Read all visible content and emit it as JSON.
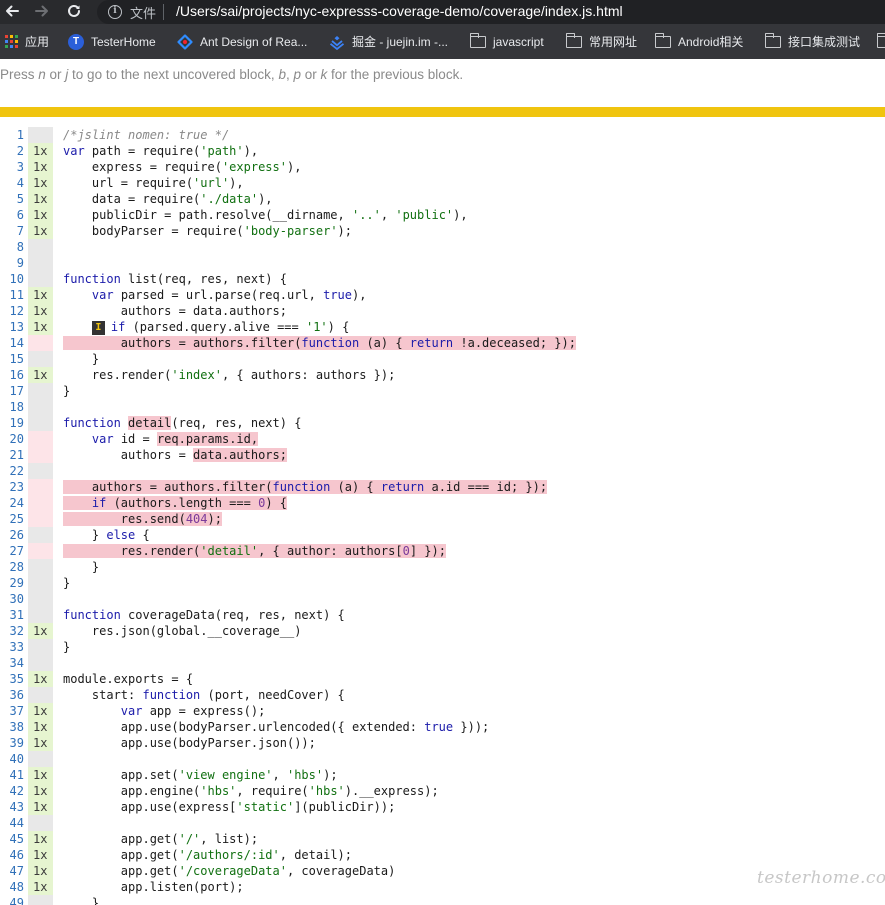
{
  "browser": {
    "back_icon": "arrow-left-icon",
    "forward_icon": "arrow-right-icon",
    "reload_icon": "reload-icon",
    "info_icon": "info-icon",
    "info_glyph": "i",
    "file_label": "文件",
    "url": "/Users/sai/projects/nyc-expresss-coverage-demo/coverage/index.js.html"
  },
  "bookmarks": [
    {
      "label": "应用",
      "icon": "apps-grid-icon"
    },
    {
      "label": "TesterHome",
      "icon": "testerhome-icon",
      "glyph": "T"
    },
    {
      "label": "Ant Design of Rea...",
      "icon": "ant-design-icon"
    },
    {
      "label": "掘金 - juejin.im -...",
      "icon": "juejin-icon"
    },
    {
      "label": "javascript",
      "icon": "folder-icon"
    },
    {
      "label": "常用网址",
      "icon": "folder-icon"
    },
    {
      "label": "Android相关",
      "icon": "folder-icon"
    },
    {
      "label": "接口集成测试",
      "icon": "folder-icon"
    }
  ],
  "help": {
    "t1": "Press ",
    "k1": "n",
    "t2": " or ",
    "k2": "j",
    "t3": " to go to the next uncovered block, ",
    "k3": "b",
    "t4": ", ",
    "k4": "p",
    "t5": " or ",
    "k5": "k",
    "t6": " for the previous block."
  },
  "colors": {
    "status_strip": "#f0c40e",
    "covered_gutter": "#e6f5d0",
    "uncovered_gutter": "#fde4e8",
    "uncovered_code": "#f6c6ce"
  },
  "code": {
    "rows": [
      {
        "n": 1,
        "cnt": "",
        "st": "",
        "segs": [
          [
            "com",
            "/*jslint nomen: true */"
          ]
        ]
      },
      {
        "n": 2,
        "cnt": "1x",
        "st": "yes",
        "segs": [
          [
            "kw",
            "var"
          ],
          [
            "",
            " path = require("
          ],
          [
            "str",
            "'path'"
          ],
          [
            "",
            "),"
          ]
        ]
      },
      {
        "n": 3,
        "cnt": "1x",
        "st": "yes",
        "segs": [
          [
            "",
            "    express = require("
          ],
          [
            "str",
            "'express'"
          ],
          [
            "",
            "),"
          ]
        ]
      },
      {
        "n": 4,
        "cnt": "1x",
        "st": "yes",
        "segs": [
          [
            "",
            "    url = require("
          ],
          [
            "str",
            "'url'"
          ],
          [
            "",
            "),"
          ]
        ]
      },
      {
        "n": 5,
        "cnt": "1x",
        "st": "yes",
        "segs": [
          [
            "",
            "    data = require("
          ],
          [
            "str",
            "'./data'"
          ],
          [
            "",
            "),"
          ]
        ]
      },
      {
        "n": 6,
        "cnt": "1x",
        "st": "yes",
        "segs": [
          [
            "",
            "    publicDir = path.resolve(__dirname, "
          ],
          [
            "str",
            "'..'"
          ],
          [
            "",
            ", "
          ],
          [
            "str",
            "'public'"
          ],
          [
            "",
            "),"
          ]
        ]
      },
      {
        "n": 7,
        "cnt": "1x",
        "st": "yes",
        "segs": [
          [
            "",
            "    bodyParser = require("
          ],
          [
            "str",
            "'body-parser'"
          ],
          [
            "",
            ");"
          ]
        ]
      },
      {
        "n": 8,
        "cnt": "",
        "st": "",
        "segs": []
      },
      {
        "n": 9,
        "cnt": "",
        "st": "",
        "segs": []
      },
      {
        "n": 10,
        "cnt": "",
        "st": "",
        "segs": [
          [
            "kw",
            "function"
          ],
          [
            "",
            " list(req, res, next) {"
          ]
        ]
      },
      {
        "n": 11,
        "cnt": "1x",
        "st": "yes",
        "segs": [
          [
            "",
            "    "
          ],
          [
            "kw",
            "var"
          ],
          [
            "",
            " parsed = url.parse(req.url, "
          ],
          [
            "kw",
            "true"
          ],
          [
            "",
            "),"
          ]
        ]
      },
      {
        "n": 12,
        "cnt": "1x",
        "st": "yes",
        "segs": [
          [
            "",
            "        authors = data.authors;"
          ]
        ]
      },
      {
        "n": 13,
        "cnt": "1x",
        "st": "yes",
        "segs": [
          [
            "",
            "    "
          ],
          [
            "mark",
            "I"
          ],
          [
            "kw",
            "if"
          ],
          [
            "",
            " (parsed.query.alive === "
          ],
          [
            "str",
            "'1'"
          ],
          [
            "",
            ") {"
          ]
        ]
      },
      {
        "n": 14,
        "cnt": "",
        "st": "no",
        "segs": [
          [
            "miss",
            [
              [
                "",
                "        authors = authors.filter("
              ],
              [
                "kw",
                "function"
              ],
              [
                "",
                " (a) { "
              ],
              [
                "kw",
                "return"
              ],
              [
                "",
                " !a.deceased; });"
              ]
            ]
          ]
        ]
      },
      {
        "n": 15,
        "cnt": "",
        "st": "",
        "segs": [
          [
            "",
            "    }"
          ]
        ]
      },
      {
        "n": 16,
        "cnt": "1x",
        "st": "yes",
        "segs": [
          [
            "",
            "    res.render("
          ],
          [
            "str",
            "'index'"
          ],
          [
            "",
            ", { authors: authors });"
          ]
        ]
      },
      {
        "n": 17,
        "cnt": "",
        "st": "",
        "segs": [
          [
            "",
            "}"
          ]
        ]
      },
      {
        "n": 18,
        "cnt": "",
        "st": "",
        "segs": []
      },
      {
        "n": 19,
        "cnt": "",
        "st": "",
        "segs": [
          [
            "kw",
            "function"
          ],
          [
            "",
            " "
          ],
          [
            "miss",
            [
              [
                "",
                "detail"
              ]
            ]
          ],
          [
            "",
            "(req, res, next) {"
          ]
        ]
      },
      {
        "n": 20,
        "cnt": "",
        "st": "no",
        "segs": [
          [
            "",
            "    "
          ],
          [
            "kw",
            "var"
          ],
          [
            "",
            " id = "
          ],
          [
            "miss",
            [
              [
                "",
                "req.params.id,"
              ]
            ]
          ]
        ]
      },
      {
        "n": 21,
        "cnt": "",
        "st": "no",
        "segs": [
          [
            "",
            "        authors = "
          ],
          [
            "miss",
            [
              [
                "",
                "data.authors;"
              ]
            ]
          ]
        ]
      },
      {
        "n": 22,
        "cnt": "",
        "st": "",
        "segs": []
      },
      {
        "n": 23,
        "cnt": "",
        "st": "no",
        "segs": [
          [
            "miss",
            [
              [
                "",
                "    authors = authors.filter("
              ],
              [
                "kw",
                "function"
              ],
              [
                "",
                " (a) { "
              ],
              [
                "kw",
                "return"
              ],
              [
                "",
                " a.id === id; });"
              ]
            ]
          ]
        ]
      },
      {
        "n": 24,
        "cnt": "",
        "st": "no",
        "segs": [
          [
            "miss",
            [
              [
                "",
                "    "
              ],
              [
                "kw",
                "if"
              ],
              [
                "",
                " (authors.length === "
              ],
              [
                "num",
                "0"
              ],
              [
                "",
                ") {"
              ]
            ]
          ]
        ]
      },
      {
        "n": 25,
        "cnt": "",
        "st": "no",
        "segs": [
          [
            "miss",
            [
              [
                "",
                "        res.send("
              ],
              [
                "num",
                "404"
              ],
              [
                "",
                ");"
              ]
            ]
          ]
        ]
      },
      {
        "n": 26,
        "cnt": "",
        "st": "",
        "segs": [
          [
            "",
            "    } "
          ],
          [
            "kw",
            "else"
          ],
          [
            "",
            " {"
          ]
        ]
      },
      {
        "n": 27,
        "cnt": "",
        "st": "no",
        "segs": [
          [
            "miss",
            [
              [
                "",
                "        res.render("
              ],
              [
                "str",
                "'detail'"
              ],
              [
                "",
                ", { author: authors["
              ],
              [
                "num",
                "0"
              ],
              [
                "",
                "] });"
              ]
            ]
          ]
        ]
      },
      {
        "n": 28,
        "cnt": "",
        "st": "",
        "segs": [
          [
            "",
            "    }"
          ]
        ]
      },
      {
        "n": 29,
        "cnt": "",
        "st": "",
        "segs": [
          [
            "",
            "}"
          ]
        ]
      },
      {
        "n": 30,
        "cnt": "",
        "st": "",
        "segs": []
      },
      {
        "n": 31,
        "cnt": "",
        "st": "",
        "segs": [
          [
            "kw",
            "function"
          ],
          [
            "",
            " coverageData(req, res, next) {"
          ]
        ]
      },
      {
        "n": 32,
        "cnt": "1x",
        "st": "yes",
        "segs": [
          [
            "",
            "    res.json(global.__coverage__)"
          ]
        ]
      },
      {
        "n": 33,
        "cnt": "",
        "st": "",
        "segs": [
          [
            "",
            "}"
          ]
        ]
      },
      {
        "n": 34,
        "cnt": "",
        "st": "",
        "segs": []
      },
      {
        "n": 35,
        "cnt": "1x",
        "st": "yes",
        "segs": [
          [
            "",
            "module.exports = {"
          ]
        ]
      },
      {
        "n": 36,
        "cnt": "",
        "st": "",
        "segs": [
          [
            "",
            "    start: "
          ],
          [
            "kw",
            "function"
          ],
          [
            "",
            " (port, needCover) {"
          ]
        ]
      },
      {
        "n": 37,
        "cnt": "1x",
        "st": "yes",
        "segs": [
          [
            "",
            "        "
          ],
          [
            "kw",
            "var"
          ],
          [
            "",
            " app = express();"
          ]
        ]
      },
      {
        "n": 38,
        "cnt": "1x",
        "st": "yes",
        "segs": [
          [
            "",
            "        app.use(bodyParser.urlencoded({ extended: "
          ],
          [
            "kw",
            "true"
          ],
          [
            "",
            " }));"
          ]
        ]
      },
      {
        "n": 39,
        "cnt": "1x",
        "st": "yes",
        "segs": [
          [
            "",
            "        app.use(bodyParser.json());"
          ]
        ]
      },
      {
        "n": 40,
        "cnt": "",
        "st": "",
        "segs": []
      },
      {
        "n": 41,
        "cnt": "1x",
        "st": "yes",
        "segs": [
          [
            "",
            "        app.set("
          ],
          [
            "str",
            "'view engine'"
          ],
          [
            "",
            ", "
          ],
          [
            "str",
            "'hbs'"
          ],
          [
            "",
            ");"
          ]
        ]
      },
      {
        "n": 42,
        "cnt": "1x",
        "st": "yes",
        "segs": [
          [
            "",
            "        app.engine("
          ],
          [
            "str",
            "'hbs'"
          ],
          [
            "",
            ", require("
          ],
          [
            "str",
            "'hbs'"
          ],
          [
            "",
            ").__express);"
          ]
        ]
      },
      {
        "n": 43,
        "cnt": "1x",
        "st": "yes",
        "segs": [
          [
            "",
            "        app.use(express["
          ],
          [
            "str",
            "'static'"
          ],
          [
            "",
            "](publicDir));"
          ]
        ]
      },
      {
        "n": 44,
        "cnt": "",
        "st": "",
        "segs": []
      },
      {
        "n": 45,
        "cnt": "1x",
        "st": "yes",
        "segs": [
          [
            "",
            "        app.get("
          ],
          [
            "str",
            "'/'"
          ],
          [
            "",
            ", list);"
          ]
        ]
      },
      {
        "n": 46,
        "cnt": "1x",
        "st": "yes",
        "segs": [
          [
            "",
            "        app.get("
          ],
          [
            "str",
            "'/authors/:id'"
          ],
          [
            "",
            ", detail);"
          ]
        ]
      },
      {
        "n": 47,
        "cnt": "1x",
        "st": "yes",
        "segs": [
          [
            "",
            "        app.get("
          ],
          [
            "str",
            "'/coverageData'"
          ],
          [
            "",
            ", coverageData)"
          ]
        ]
      },
      {
        "n": 48,
        "cnt": "1x",
        "st": "yes",
        "segs": [
          [
            "",
            "        app.listen(port);"
          ]
        ]
      },
      {
        "n": 49,
        "cnt": "",
        "st": "",
        "segs": [
          [
            "",
            "    }"
          ]
        ]
      }
    ]
  },
  "watermark": "testerhome.com"
}
